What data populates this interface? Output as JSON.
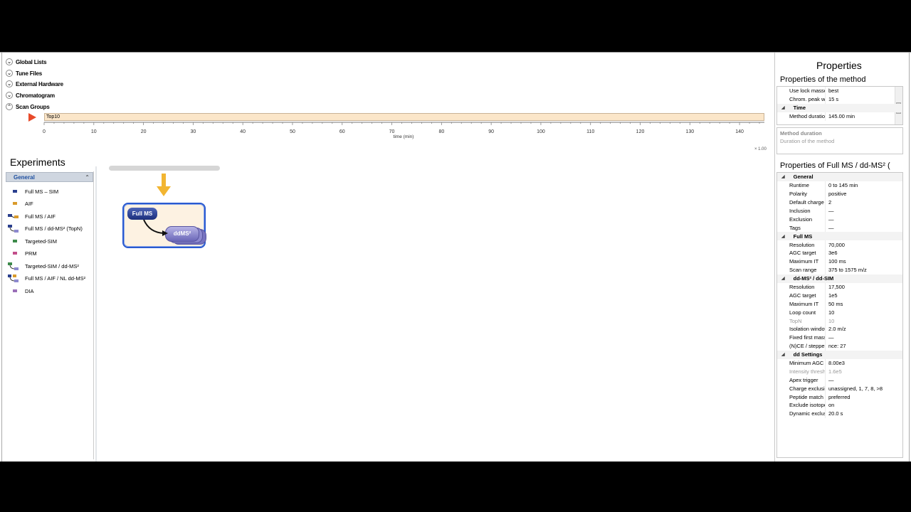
{
  "sections": [
    {
      "label": "Global Lists",
      "expanded": false
    },
    {
      "label": "Tune Files",
      "expanded": false
    },
    {
      "label": "External Hardware",
      "expanded": false
    },
    {
      "label": "Chromatogram",
      "expanded": false
    },
    {
      "label": "Scan Groups",
      "expanded": true
    }
  ],
  "scan_group": {
    "name": "Top10"
  },
  "timeline": {
    "axis_label": "time (min)",
    "ticks": [
      "0",
      "10",
      "20",
      "30",
      "40",
      "50",
      "60",
      "70",
      "80",
      "90",
      "100",
      "110",
      "120",
      "130",
      "140"
    ],
    "range": [
      0,
      145
    ],
    "zoom": "× 1.00"
  },
  "experiments": {
    "title": "Experiments",
    "group": "General",
    "items": [
      {
        "label": "Full MS – SIM",
        "icon": "full-ms-sim-icon"
      },
      {
        "label": "AIF",
        "icon": "aif-icon"
      },
      {
        "label": "Full MS / AIF",
        "icon": "full-ms-aif-icon"
      },
      {
        "label": "Full MS / dd-MS² (TopN)",
        "icon": "full-ms-ddms2-icon"
      },
      {
        "label": "Targeted-SIM",
        "icon": "targeted-sim-icon"
      },
      {
        "label": "PRM",
        "icon": "prm-icon"
      },
      {
        "label": "Targeted-SIM / dd-MS²",
        "icon": "targeted-sim-ddms2-icon"
      },
      {
        "label": "Full MS / AIF / NL dd-MS²",
        "icon": "full-ms-aif-nl-icon"
      },
      {
        "label": "DIA",
        "icon": "dia-icon"
      }
    ]
  },
  "workflow": {
    "node_full": "Full MS",
    "node_dd": "ddMS²"
  },
  "properties": {
    "title": "Properties",
    "method_header": "Properties of the method",
    "method_rows": [
      {
        "name": "Use lock masses",
        "value": "best",
        "type": "row"
      },
      {
        "name": "Chrom. peak width",
        "value": "15 s",
        "type": "row"
      },
      {
        "name": "Time",
        "value": "",
        "type": "cat"
      },
      {
        "name": "Method duration",
        "value": "145.00 min",
        "type": "row"
      }
    ],
    "description_title": "Method duration",
    "description_text": "Duration of the method",
    "experiment_header": "Properties of Full MS / dd-MS² (",
    "experiment_rows": [
      {
        "name": "General",
        "value": "",
        "type": "cat"
      },
      {
        "name": "Runtime",
        "value": "0 to 145 min",
        "type": "row"
      },
      {
        "name": "Polarity",
        "value": "positive",
        "type": "row"
      },
      {
        "name": "Default charge state",
        "value": "2",
        "type": "row"
      },
      {
        "name": "Inclusion",
        "value": "—",
        "type": "row"
      },
      {
        "name": "Exclusion",
        "value": "—",
        "type": "row"
      },
      {
        "name": "Tags",
        "value": "—",
        "type": "row"
      },
      {
        "name": "Full MS",
        "value": "",
        "type": "cat"
      },
      {
        "name": "Resolution",
        "value": "70,000",
        "type": "row"
      },
      {
        "name": "AGC target",
        "value": "3e6",
        "type": "row"
      },
      {
        "name": "Maximum IT",
        "value": "100 ms",
        "type": "row"
      },
      {
        "name": "Scan range",
        "value": "375 to 1575 m/z",
        "type": "row"
      },
      {
        "name": "dd-MS² / dd-SIM",
        "value": "",
        "type": "cat"
      },
      {
        "name": "Resolution",
        "value": "17,500",
        "type": "row"
      },
      {
        "name": "AGC target",
        "value": "1e5",
        "type": "row"
      },
      {
        "name": "Maximum IT",
        "value": "50 ms",
        "type": "row"
      },
      {
        "name": "Loop count",
        "value": "10",
        "type": "row"
      },
      {
        "name": "TopN",
        "value": "10",
        "type": "dim"
      },
      {
        "name": "Isolation window",
        "value": "2.0 m/z",
        "type": "row"
      },
      {
        "name": "Fixed first mass",
        "value": "—",
        "type": "row"
      },
      {
        "name": "(N)CE / stepped nce",
        "value": "nce: 27",
        "type": "row"
      },
      {
        "name": "dd Settings",
        "value": "",
        "type": "cat"
      },
      {
        "name": "Minimum AGC target",
        "value": "8.00e3",
        "type": "row"
      },
      {
        "name": "Intensity threshold",
        "value": "1.6e5",
        "type": "dim"
      },
      {
        "name": "Apex trigger",
        "value": "—",
        "type": "row"
      },
      {
        "name": "Charge exclusion",
        "value": "unassigned, 1, 7, 8, >8",
        "type": "row"
      },
      {
        "name": "Peptide match",
        "value": "preferred",
        "type": "row"
      },
      {
        "name": "Exclude isotopes",
        "value": "on",
        "type": "row"
      },
      {
        "name": "Dynamic exclusion",
        "value": "20.0 s",
        "type": "row"
      }
    ]
  },
  "colors": {
    "scan_bar": "#fbe6c9",
    "accent": "#1e4fa0",
    "node_border": "#2a5ad0",
    "arrow": "#e84a2a"
  }
}
